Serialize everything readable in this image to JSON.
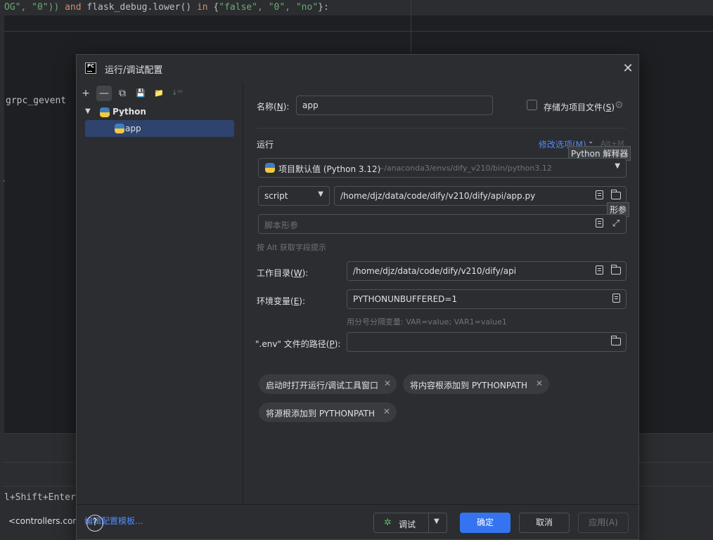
{
  "background": {
    "code_line_parts": [
      "OG\", \"0\")) ",
      "and",
      " flask_debug.lower() ",
      "in",
      " {",
      "\"false\", \"0\", \"no\"",
      "}:"
    ],
    "side_text": "grpc_gevent",
    "shortcut_text": "l+Shift+Enter",
    "controllers_text": "<controllers.cons"
  },
  "dialog": {
    "title": "运行/调试配置",
    "close_glyph": "✕",
    "toolbar": {
      "add": "+",
      "remove": "—",
      "copy": "⧉",
      "save": "💾",
      "new_folder": "📁",
      "sort": "↓ᵃᶻ"
    },
    "tree": {
      "group_label": "Python",
      "item_label": "app"
    },
    "edit_templates": "编辑配置模板...",
    "name": {
      "label_prefix": "名称(",
      "label_key": "N",
      "label_suffix": "):",
      "value": "app"
    },
    "store_as_project_file": {
      "label_prefix": "存储为项目文件(",
      "label_key": "S",
      "label_suffix": ")"
    },
    "run_section": "运行",
    "modify_options": "修改选项(M)",
    "modify_shortcut": "Alt+M",
    "interpreter_tooltip": "Python 解释器",
    "interpreter": {
      "name": "项目默认值 (Python 3.12)",
      "path": "~/anaconda3/envs/dify_v210/bin/python3.12"
    },
    "script_type": "script",
    "script_path": "/home/djz/data/code/dify/v210/dify/api/app.py",
    "params_tooltip": "形参",
    "script_params_placeholder": "脚本形参",
    "alt_hint": "按 Alt 获取字段提示",
    "working_dir": {
      "label_prefix": "工作目录(",
      "label_key": "W",
      "label_suffix": "):",
      "value": "/home/djz/data/code/dify/v210/dify/api"
    },
    "env_vars": {
      "label_prefix": "环境变量(",
      "label_key": "E",
      "label_suffix": "):",
      "value": "PYTHONUNBUFFERED=1",
      "hint": "用分号分隔变量: VAR=value; VAR1=value1"
    },
    "env_file": {
      "label_prefix": "\".env\" 文件的路径(",
      "label_key": "P",
      "label_suffix": "):",
      "value": ""
    },
    "chips": [
      "启动时打开运行/调试工具窗口",
      "将内容根添加到 PYTHONPATH",
      "将源根添加到 PYTHONPATH"
    ],
    "footer": {
      "help": "?",
      "debug": "调试",
      "ok": "确定",
      "cancel": "取消",
      "apply": "应用(A)"
    }
  },
  "colors": {
    "accent": "#3574f0",
    "link": "#548af7",
    "selection": "#2e436e",
    "debug_icon": "#5fb85f"
  }
}
